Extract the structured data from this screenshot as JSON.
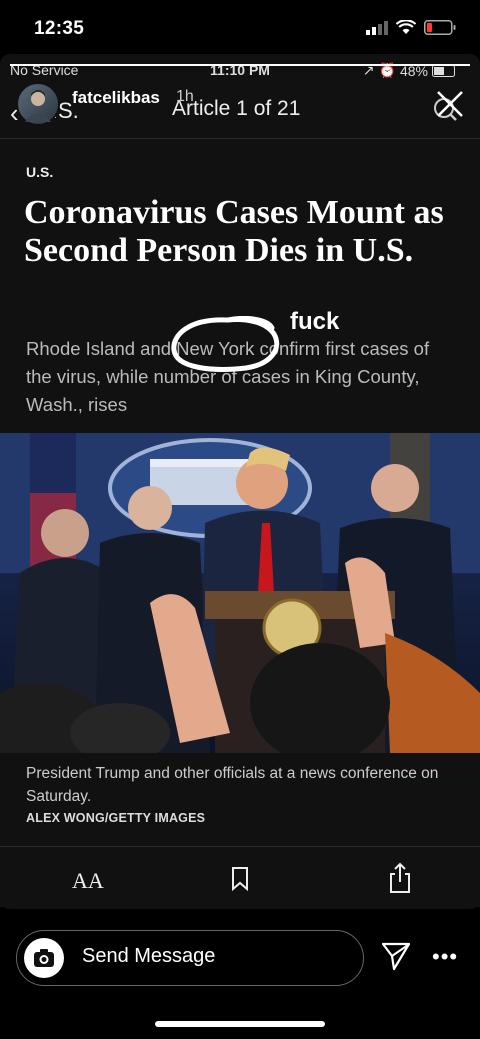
{
  "device_status": {
    "time": "12:35"
  },
  "inner_status": {
    "carrier": "No Service",
    "time": "11:10 PM",
    "battery": "48%"
  },
  "story": {
    "username": "fatcelikbas",
    "age": "1h",
    "progress": 1.0
  },
  "article_header": {
    "back_label": "U.S.",
    "counter": "Article 1 of 21"
  },
  "article": {
    "section": "U.S.",
    "headline": "Coronavirus Cases Mount as Second Person Dies in U.S.",
    "summary": "Rhode Island and New York confirm first cases of the virus, while number of cases in King County, Wash., rises",
    "annotation": "fuck",
    "caption": "President Trump and other officials at a news conference on Saturday.",
    "credit": "ALEX WONG/GETTY IMAGES"
  },
  "toolbar": {
    "font_size_label": "AA"
  },
  "reply": {
    "placeholder": "Send Message",
    "more": "•••"
  },
  "colors": {
    "background": "#000000",
    "story_bg": "#111111",
    "text": "#ffffff",
    "muted": "#bbbbbb"
  }
}
